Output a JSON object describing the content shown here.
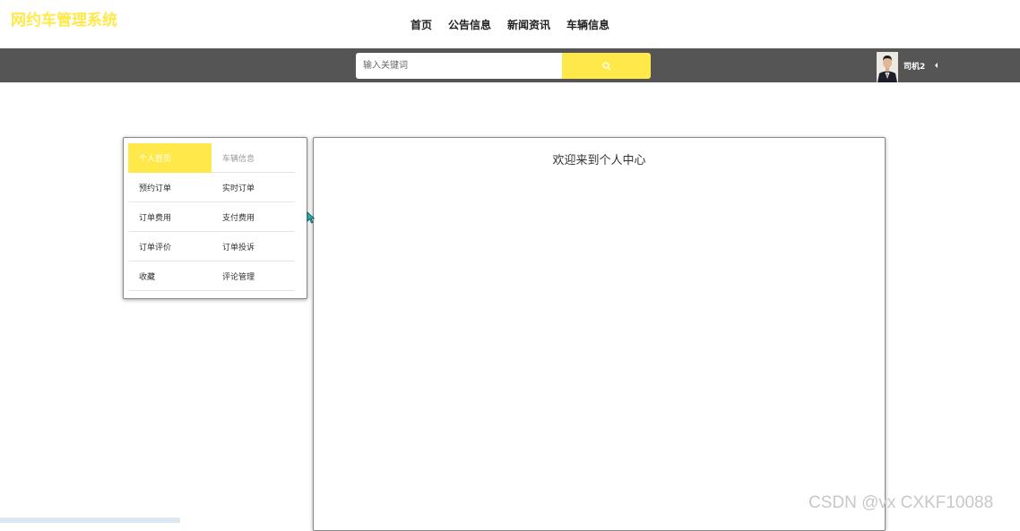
{
  "top_nav": {
    "items": [
      {
        "label": "首页"
      },
      {
        "label": "公告信息"
      },
      {
        "label": "新闻资讯"
      },
      {
        "label": "车辆信息"
      }
    ]
  },
  "header": {
    "brand": "网约车管理系统",
    "search": {
      "placeholder": "输入关键词",
      "value": "",
      "button_icon": "search-icon"
    },
    "user": {
      "name": "司机2",
      "avatar_icon": "avatar-image",
      "caret_icon": "caret-left-icon"
    }
  },
  "side_menu": {
    "items": [
      {
        "label": "个人首页",
        "active": true
      },
      {
        "label": "车辆信息"
      },
      {
        "label": "预约订单"
      },
      {
        "label": "实时订单"
      },
      {
        "label": "订单费用"
      },
      {
        "label": "支付费用"
      },
      {
        "label": "订单评价"
      },
      {
        "label": "订单投诉"
      },
      {
        "label": "收藏"
      },
      {
        "label": "评论管理"
      }
    ]
  },
  "main": {
    "title": "欢迎来到个人中心"
  },
  "watermark": "CSDN @vx  CXKF10088",
  "colors": {
    "accent": "#ffe84a",
    "header_bg": "#555555",
    "page_bg": "#ffffff"
  }
}
